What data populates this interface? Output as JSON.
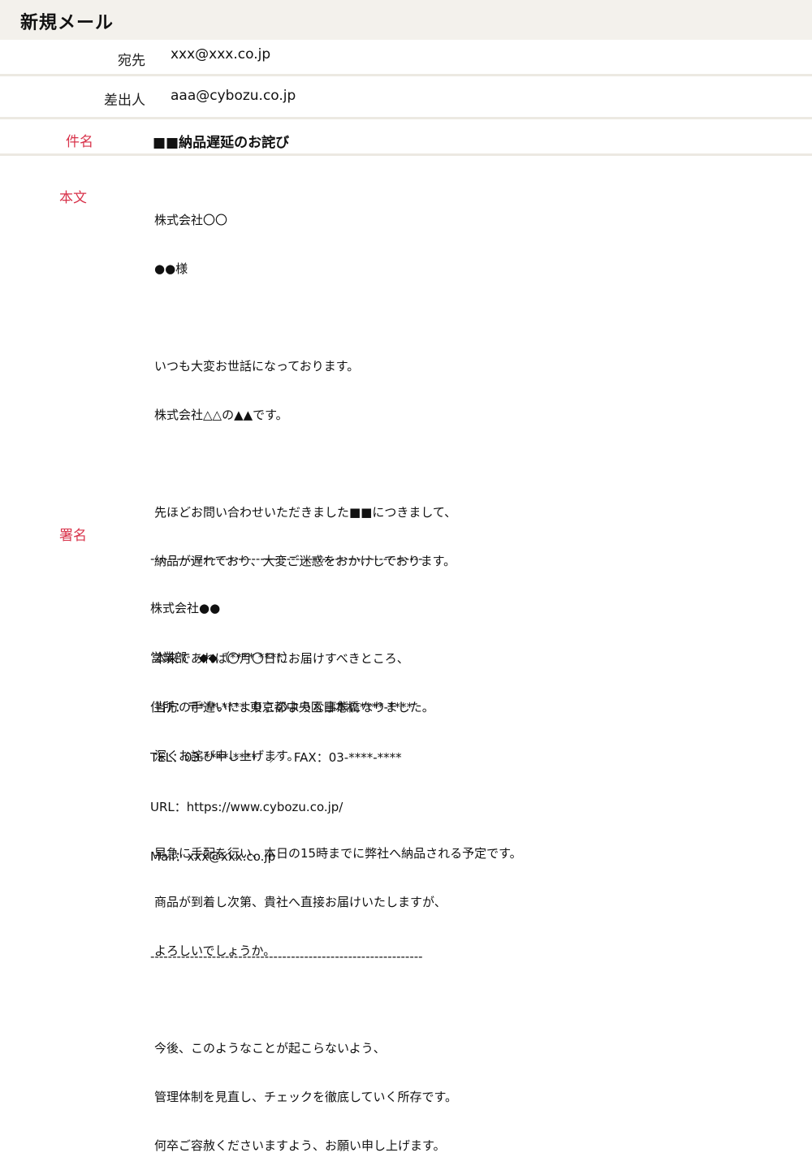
{
  "header": {
    "title": "新規メール"
  },
  "to": {
    "label": "宛先",
    "value": "xxx@xxx.co.jp"
  },
  "from": {
    "label": "差出人",
    "value": "aaa@cybozu.co.jp"
  },
  "subject": {
    "label": "件名",
    "value": "■■納品遅延のお詫び"
  },
  "body": {
    "label": "本文",
    "lines": [
      "株式会社〇〇",
      "●●様",
      "",
      "いつも大変お世話になっております。",
      "株式会社△△の▲▲です。",
      "",
      "先ほどお問い合わせいただきました■■につきまして、",
      "納品が遅れており、大変ご迷惑をおかけしております。",
      "",
      "本来であれば〇月〇日にお届けすべきところ、",
      "当方の手違いによりこのような事態になりました。",
      "深くお詫び申し上げます。",
      "",
      "早急に手配を行い、本日の15時までに弊社へ納品される予定です。",
      "商品が到着し次第、貴社へ直接お届けいたしますが、",
      "よろしいでしょうか。",
      "",
      "今後、このようなことが起こらないよう、",
      "管理体制を見直し、チェックを徹底していく所存です。",
      "何卒ご容赦くださいますよう、お願い申し上げます。"
    ]
  },
  "signature": {
    "label": "署名",
    "lines": [
      "--------------------------------------------------------------",
      "株式会社●●",
      "営業部　◆◆（**** ****）",
      "住所：〒***-**** 東京都中央区日本橋****-****",
      "TEL：03-****-****　／　FAX：03-****-****",
      "URL：https://www.cybozu.co.jp/",
      "Mail：xxx@xxx.co.jp",
      "",
      "--------------------------------------------------------------"
    ]
  },
  "colors": {
    "header_bg": "#f3f1ec",
    "separator": "#ece9e2",
    "accent_label": "#d8324a"
  }
}
